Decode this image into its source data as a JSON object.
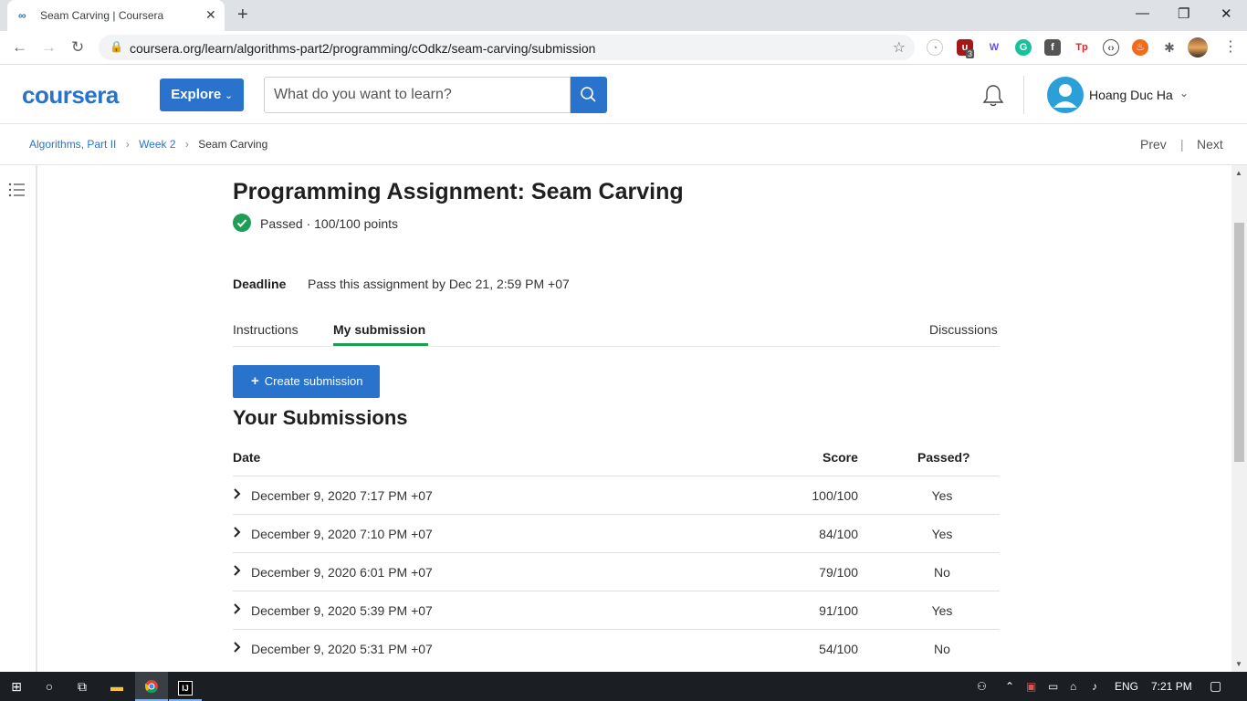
{
  "browser": {
    "tab_title": "Seam Carving | Coursera",
    "url": "coursera.org/learn/algorithms-part2/programming/cOdkz/seam-carving/submission",
    "extension_badge": "3"
  },
  "header": {
    "logo": "coursera",
    "explore_label": "Explore",
    "search_placeholder": "What do you want to learn?",
    "user_name": "Hoang Duc Ha"
  },
  "breadcrumb": {
    "items": [
      "Algorithms, Part II",
      "Week 2",
      "Seam Carving"
    ],
    "prev": "Prev",
    "next": "Next",
    "separator": "|"
  },
  "assignment": {
    "title": "Programming Assignment: Seam Carving",
    "status": "Passed · 100/100 points",
    "deadline_label": "Deadline",
    "deadline_text": "Pass this assignment by Dec 21, 2:59 PM +07"
  },
  "tabs": {
    "instructions": "Instructions",
    "my_submission": "My submission",
    "discussions": "Discussions"
  },
  "submissions": {
    "create_label": "Create submission",
    "heading": "Your Submissions",
    "columns": {
      "date": "Date",
      "score": "Score",
      "passed": "Passed?"
    },
    "rows": [
      {
        "date": "December 9, 2020 7:17 PM +07",
        "score": "100/100",
        "passed": "Yes"
      },
      {
        "date": "December 9, 2020 7:10 PM +07",
        "score": "84/100",
        "passed": "Yes"
      },
      {
        "date": "December 9, 2020 6:01 PM +07",
        "score": "79/100",
        "passed": "No"
      },
      {
        "date": "December 9, 2020 5:39 PM +07",
        "score": "91/100",
        "passed": "Yes"
      },
      {
        "date": "December 9, 2020 5:31 PM +07",
        "score": "54/100",
        "passed": "No"
      }
    ]
  },
  "taskbar": {
    "lang": "ENG",
    "time": "7:21 PM",
    "ide_label": "IJ"
  },
  "colors": {
    "accent": "#2a73cc",
    "success": "#1f9d55"
  }
}
